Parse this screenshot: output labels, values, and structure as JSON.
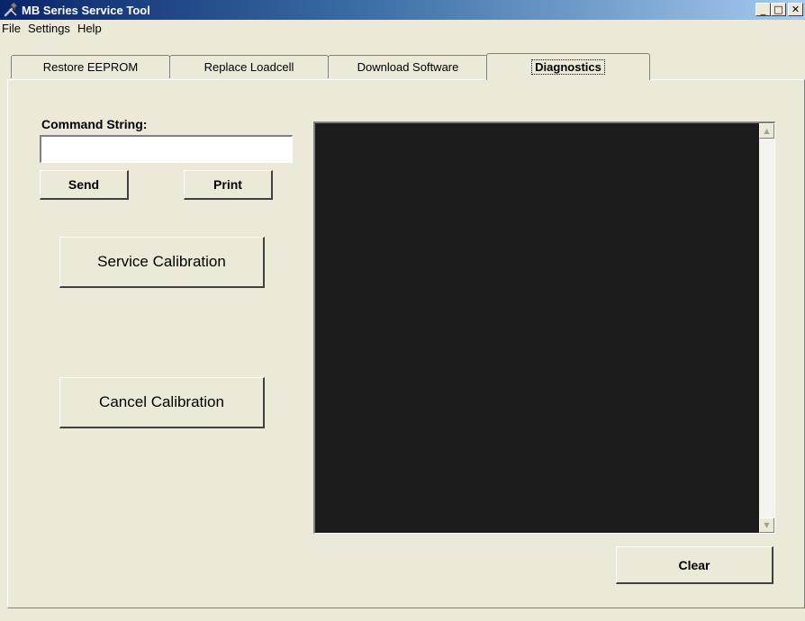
{
  "window": {
    "title": "MB Series Service Tool",
    "minimize_glyph": "_",
    "maximize_glyph": "□",
    "close_glyph": "✕"
  },
  "menu": [
    "File",
    "Settings",
    "Help"
  ],
  "tabs": [
    {
      "label": "Restore EEPROM",
      "active": false
    },
    {
      "label": "Replace Loadcell",
      "active": false
    },
    {
      "label": "Download Software",
      "active": false
    },
    {
      "label": "Diagnostics",
      "active": true
    }
  ],
  "diagnostics": {
    "command_label": "Command String:",
    "command_value": "",
    "send_label": "Send",
    "print_label": "Print",
    "service_calibration_label": "Service Calibration",
    "cancel_calibration_label": "Cancel Calibration",
    "clear_label": "Clear"
  },
  "console": {
    "scroll_up_glyph": "▲",
    "scroll_down_glyph": "▼"
  }
}
